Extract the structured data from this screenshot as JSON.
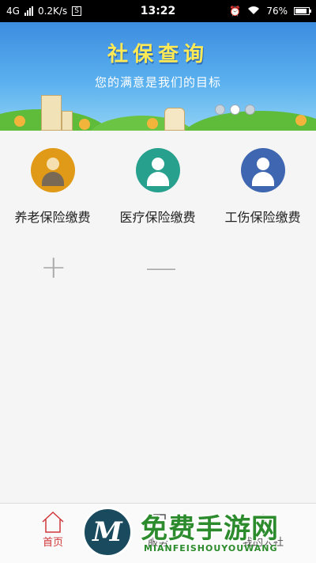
{
  "status_bar": {
    "network": "4G",
    "speed": "0.2K/s",
    "s_badge": "S",
    "time": "13:22",
    "battery": "76%"
  },
  "banner": {
    "title": "社保查询",
    "subtitle": "您的满意是我们的目标"
  },
  "services": [
    {
      "label": "养老保险缴费",
      "icon": "elderly-person-icon",
      "color": "#e09a17"
    },
    {
      "label": "医疗保险缴费",
      "icon": "nurse-icon",
      "color": "#27a08d"
    },
    {
      "label": "工伤保险缴费",
      "icon": "injured-worker-icon",
      "color": "#3f66b0"
    }
  ],
  "controls": {
    "plus": "+",
    "minus": "—"
  },
  "nav": {
    "home": "首页",
    "service": "服务",
    "mine": "我的人社"
  },
  "watermark": {
    "logo_letter": "M",
    "text": "免费手游网",
    "sub": "MIANFEISHOUYOUWANG"
  },
  "colors": {
    "accent": "#d0373a",
    "banner_title": "#ffe955"
  }
}
